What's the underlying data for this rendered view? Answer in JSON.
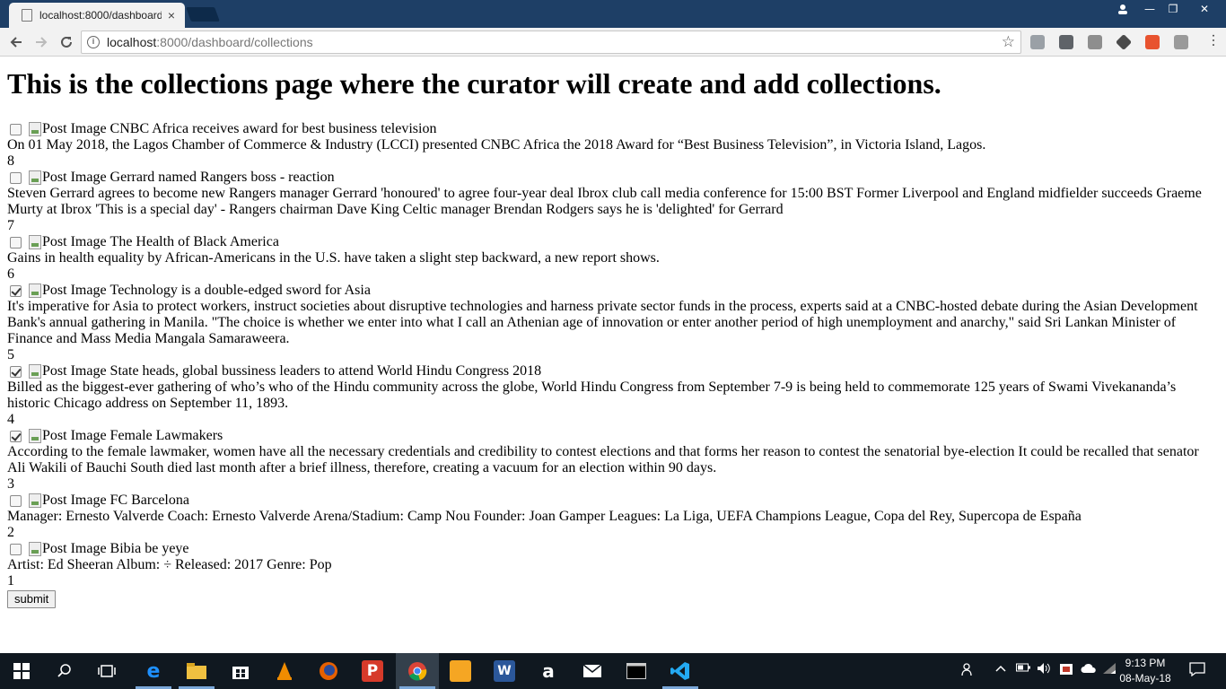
{
  "browser": {
    "tab_title": "localhost:8000/dashboard/",
    "tab_close": "×",
    "url_host": "localhost",
    "url_rest": ":8000/dashboard/collections",
    "window_controls": {
      "minimize": "—",
      "restore": "❐",
      "close": "✕"
    }
  },
  "page": {
    "heading": "This is the collections page where the curator will create and add collections.",
    "image_alt": "Post Image",
    "posts": [
      {
        "title": "CNBC Africa receives award for best business television",
        "description": "On 01 May 2018, the Lagos Chamber of Commerce & Industry (LCCI) presented CNBC Africa the 2018 Award for “Best Business Television”, in Victoria Island, Lagos.",
        "number": "8",
        "checked": false
      },
      {
        "title": "Gerrard named Rangers boss - reaction",
        "description": "Steven Gerrard agrees to become new Rangers manager Gerrard 'honoured' to agree four-year deal Ibrox club call media conference for 15:00 BST Former Liverpool and England midfielder succeeds Graeme Murty at Ibrox 'This is a special day' - Rangers chairman Dave King Celtic manager Brendan Rodgers says he is 'delighted' for Gerrard",
        "number": "7",
        "checked": false
      },
      {
        "title": "The Health of Black America",
        "description": "Gains in health equality by African-Americans in the U.S. have taken a slight step backward, a new report shows.",
        "number": "6",
        "checked": false
      },
      {
        "title": "Technology is a double-edged sword for Asia",
        "description": "It's imperative for Asia to protect workers, instruct societies about disruptive technologies and harness private sector funds in the process, experts said at a CNBC-hosted debate during the Asian Development Bank's annual gathering in Manila. \"The choice is whether we enter into what I call an Athenian age of innovation or enter another period of high unemployment and anarchy,\" said Sri Lankan Minister of Finance and Mass Media Mangala Samaraweera.",
        "number": "5",
        "checked": true
      },
      {
        "title": "State heads, global bussiness leaders to attend World Hindu Congress 2018",
        "description": "Billed as the biggest-ever gathering of who’s who of the Hindu community across the globe, World Hindu Congress from September 7-9 is being held to commemorate 125 years of Swami Vivekananda’s historic Chicago address on September 11, 1893.",
        "number": "4",
        "checked": true
      },
      {
        "title": "Female Lawmakers",
        "description": "According to the female lawmaker, women have all the necessary credentials and credibility to contest elections and that forms her reason to contest the senatorial bye-election It could be recalled that senator Ali Wakili of Bauchi South died last month after a brief illness, therefore, creating a vacuum for an election within 90 days.",
        "number": "3",
        "checked": true
      },
      {
        "title": "FC Barcelona",
        "description": "Manager: Ernesto Valverde Coach: Ernesto Valverde Arena/Stadium: Camp Nou Founder: Joan Gamper Leagues: La Liga, UEFA Champions League, Copa del Rey, Supercopa de España",
        "number": "2",
        "checked": false
      },
      {
        "title": "Bibia be yeye",
        "description": "Artist: Ed Sheeran Album: ÷ Released: 2017 Genre: Pop",
        "number": "1",
        "checked": false
      }
    ],
    "submit_label": "submit"
  },
  "taskbar": {
    "time": "9:13 PM",
    "date": "08-May-18"
  }
}
